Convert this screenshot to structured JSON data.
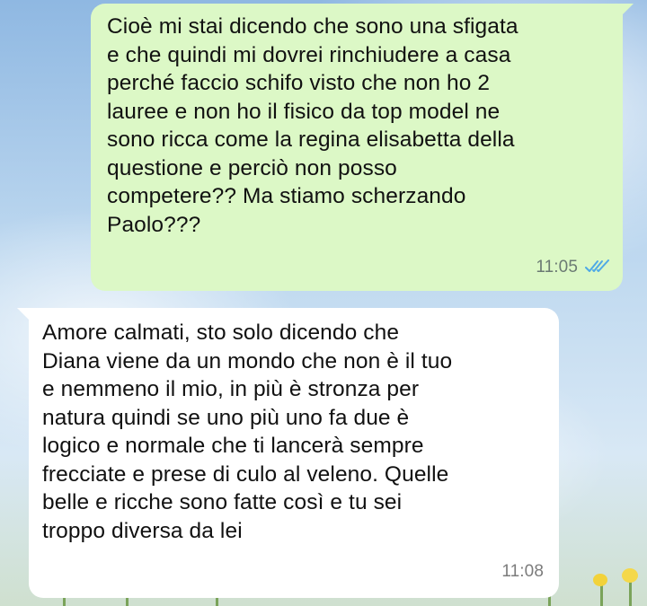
{
  "theme": {
    "outgoing_bubble_color": "#dcf8c6",
    "incoming_bubble_color": "#ffffff",
    "read_tick_color": "#4fa9e6",
    "wallpaper": "sky-and-flowers"
  },
  "messages": [
    {
      "direction": "outgoing",
      "lines": [
        "Cioè mi stai dicendo che sono una sfigata",
        "e che quindi mi dovrei rinchiudere a casa",
        "perché faccio schifo visto che non ho 2",
        "lauree e non ho il fisico da top model ne",
        "sono ricca come la regina elisabetta della",
        "questione e perciò non posso",
        "competere?? Ma stiamo scherzando",
        "Paolo???"
      ],
      "time": "11:05",
      "status_icon": "double-check-read-icon"
    },
    {
      "direction": "incoming",
      "lines": [
        "Amore calmati, sto solo dicendo che",
        "Diana viene da un mondo che non è il tuo",
        "e nemmeno il mio, in più è stronza per",
        "natura quindi se uno più uno fa due è",
        "logico e normale che ti lancerà sempre",
        "frecciate e prese di culo al veleno. Quelle",
        "belle e ricche sono fatte così e tu sei",
        "troppo diversa da lei"
      ],
      "time": "11:08"
    }
  ]
}
